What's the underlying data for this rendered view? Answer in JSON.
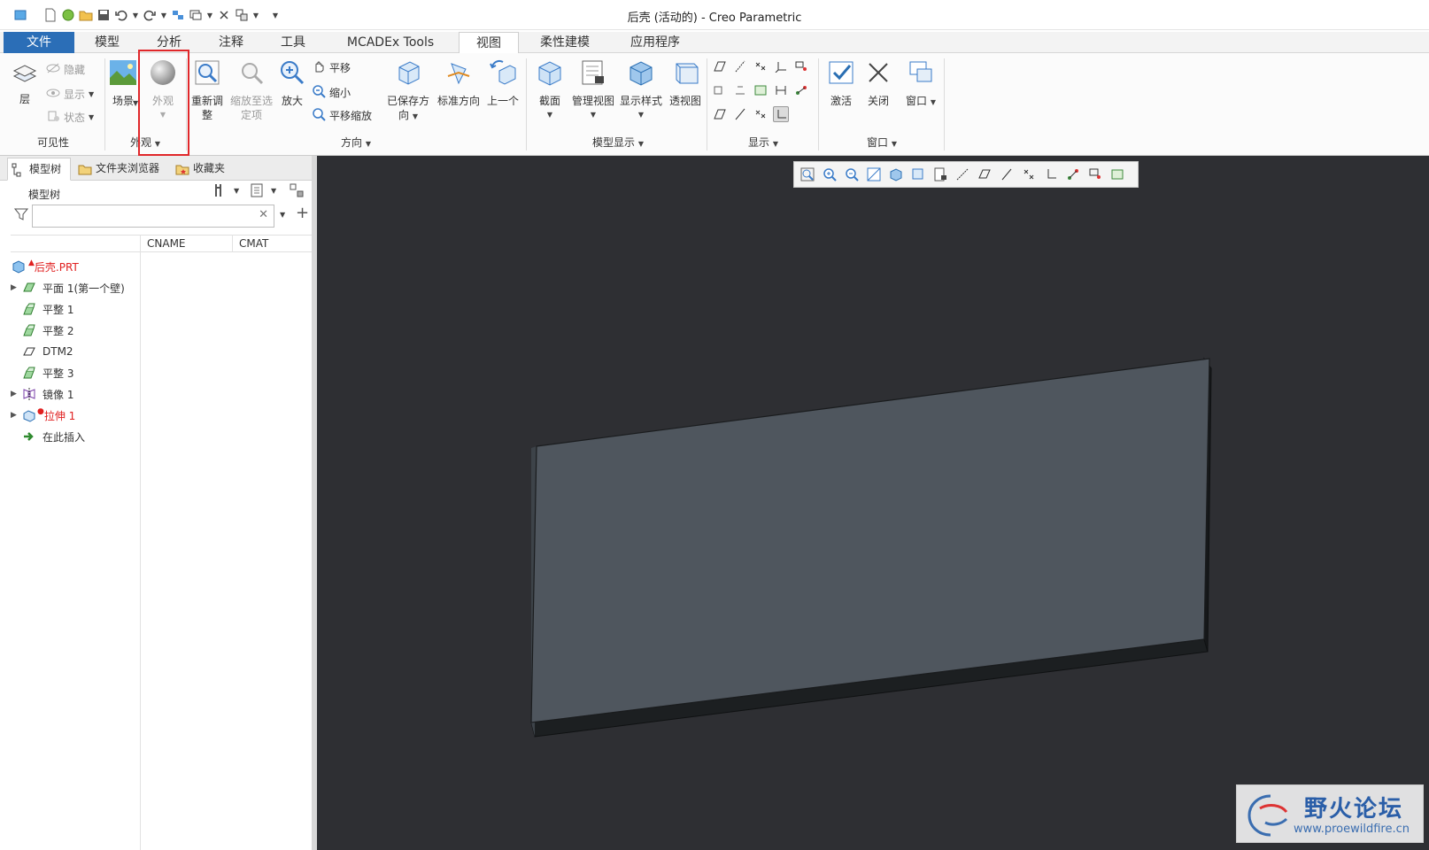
{
  "window": {
    "title": "后壳 (活动的) - Creo Parametric"
  },
  "ribbon_tabs": [
    {
      "label": "文件"
    },
    {
      "label": "模型"
    },
    {
      "label": "分析"
    },
    {
      "label": "注释"
    },
    {
      "label": "工具"
    },
    {
      "label": "MCADEx Tools"
    },
    {
      "label": "视图"
    },
    {
      "label": "柔性建模"
    },
    {
      "label": "应用程序"
    }
  ],
  "active_tab": "视图",
  "ribbon": {
    "visibility": {
      "layer": "层",
      "hide": "隐藏",
      "show": "显示",
      "status": "状态",
      "group_label": "可见性"
    },
    "appearance": {
      "scene": "场景",
      "appearance": "外观",
      "group_label": "外观"
    },
    "orientation": {
      "refit_line1": "重新调",
      "refit_line2": "整",
      "zoom_selected_line1": "缩放至选",
      "zoom_selected_line2": "定项",
      "zoom_in": "放大",
      "pan": "平移",
      "zoom_out": "缩小",
      "pan_zoom": "平移缩放",
      "saved_orient_line1": "已保存方",
      "saved_orient_line2": "向",
      "standard_orient": "标准方向",
      "previous": "上一个",
      "group_label": "方向"
    },
    "model_display": {
      "section": "截面",
      "manage_views": "管理视图",
      "display_style": "显示样式",
      "perspective": "透视图",
      "group_label": "模型显示"
    },
    "display": {
      "group_label": "显示"
    },
    "window": {
      "activate": "激活",
      "close": "关闭",
      "windows": "窗口",
      "group_label": "窗口"
    }
  },
  "nav_tabs": [
    {
      "label": "模型树"
    },
    {
      "label": "文件夹浏览器"
    },
    {
      "label": "收藏夹"
    }
  ],
  "model_tree": {
    "title": "模型树",
    "filter_placeholder": "",
    "columns": [
      "CNAME",
      "CMAT"
    ],
    "items": [
      {
        "label": "后壳.PRT",
        "icon": "part-icon",
        "expandable": false,
        "color": "#e02020"
      },
      {
        "label": "平面 1(第一个壁)",
        "icon": "planar-wall-icon",
        "expandable": true
      },
      {
        "label": "平整 1",
        "icon": "flat-wall-icon",
        "expandable": false
      },
      {
        "label": "平整 2",
        "icon": "flat-wall-icon",
        "expandable": false
      },
      {
        "label": "DTM2",
        "icon": "datum-plane-icon",
        "expandable": false
      },
      {
        "label": "平整 3",
        "icon": "flat-wall-icon",
        "expandable": false
      },
      {
        "label": "镜像 1",
        "icon": "mirror-icon",
        "expandable": true
      },
      {
        "label": "拉伸 1",
        "icon": "extrude-icon",
        "expandable": true,
        "color": "#e02020"
      },
      {
        "label": "在此插入",
        "icon": "insert-here-icon",
        "expandable": false
      }
    ]
  },
  "watermark": {
    "text": "野火论坛",
    "url": "www.proewildfire.cn"
  },
  "colors": {
    "file_tab": "#2b6eb7",
    "graphics_bg": "#2e2f33",
    "model_face": "#4f565e",
    "highlight": "#e0272a",
    "error_text": "#e02020"
  }
}
